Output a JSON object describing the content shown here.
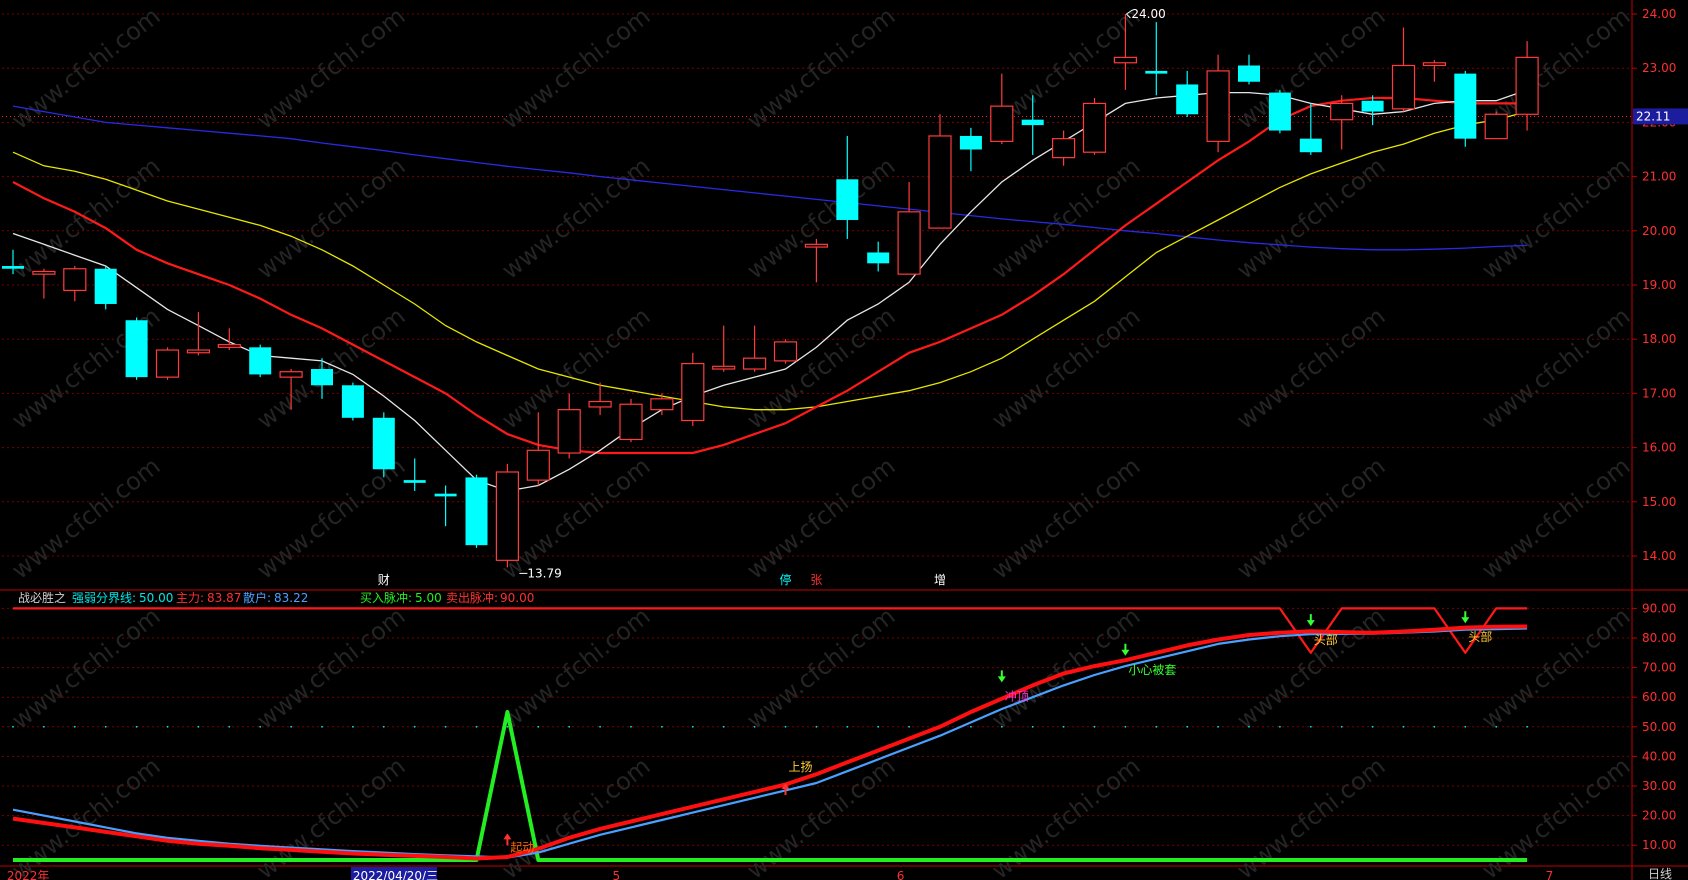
{
  "colors": {
    "up": "#ff3b3b",
    "down": "#00ffff",
    "ma5": "#e6e6e6",
    "ma10": "#ff1a1a",
    "ma20": "#e6e600",
    "ma60": "#2a2ae6",
    "grid": "#7a0000",
    "frame": "#c00000",
    "mainLine": "#ff1010",
    "retailLine": "#4aa0ff",
    "green": "#22ee22",
    "axisText": "#ff3030",
    "priceTag": "#1c1c9e"
  },
  "chart_data": [
    {
      "type": "candlestick",
      "title": "",
      "ylim": [
        13.7,
        24.2
      ],
      "yticks": [
        "24.00",
        "23.00",
        "22.00",
        "21.00",
        "20.00",
        "19.00",
        "18.00",
        "17.00",
        "16.00",
        "15.00",
        "14.00"
      ],
      "current_price": "22.11",
      "annotations": {
        "high": "24.00",
        "low": "13.79"
      },
      "event_markers": [
        "财",
        "停",
        "张",
        "增"
      ],
      "candles": [
        {
          "o": 19.35,
          "c": 19.3,
          "h": 19.65,
          "l": 19.2
        },
        {
          "o": 19.2,
          "c": 19.25,
          "h": 19.3,
          "l": 18.75
        },
        {
          "o": 18.9,
          "c": 19.3,
          "h": 19.35,
          "l": 18.7
        },
        {
          "o": 19.3,
          "c": 18.65,
          "h": 19.35,
          "l": 18.55
        },
        {
          "o": 18.35,
          "c": 17.3,
          "h": 18.4,
          "l": 17.25
        },
        {
          "o": 17.3,
          "c": 17.8,
          "h": 17.85,
          "l": 17.25
        },
        {
          "o": 17.75,
          "c": 17.8,
          "h": 18.5,
          "l": 17.7
        },
        {
          "o": 17.85,
          "c": 17.9,
          "h": 18.2,
          "l": 17.8
        },
        {
          "o": 17.85,
          "c": 17.35,
          "h": 17.9,
          "l": 17.3
        },
        {
          "o": 17.3,
          "c": 17.4,
          "h": 17.45,
          "l": 16.7
        },
        {
          "o": 17.45,
          "c": 17.15,
          "h": 17.65,
          "l": 16.9
        },
        {
          "o": 17.15,
          "c": 16.55,
          "h": 17.2,
          "l": 16.5
        },
        {
          "o": 16.55,
          "c": 15.6,
          "h": 16.65,
          "l": 15.45
        },
        {
          "o": 15.4,
          "c": 15.35,
          "h": 15.8,
          "l": 15.2
        },
        {
          "o": 15.15,
          "c": 15.1,
          "h": 15.3,
          "l": 14.55
        },
        {
          "o": 15.45,
          "c": 14.2,
          "h": 15.5,
          "l": 14.15
        },
        {
          "o": 13.92,
          "c": 15.55,
          "h": 15.7,
          "l": 13.79
        },
        {
          "o": 15.4,
          "c": 15.95,
          "h": 16.65,
          "l": 15.3
        },
        {
          "o": 15.9,
          "c": 16.7,
          "h": 17.0,
          "l": 15.8
        },
        {
          "o": 16.75,
          "c": 16.85,
          "h": 17.2,
          "l": 16.6
        },
        {
          "o": 16.15,
          "c": 16.8,
          "h": 16.9,
          "l": 16.1
        },
        {
          "o": 16.7,
          "c": 16.9,
          "h": 17.0,
          "l": 16.6
        },
        {
          "o": 16.5,
          "c": 17.55,
          "h": 17.75,
          "l": 16.4
        },
        {
          "o": 17.45,
          "c": 17.5,
          "h": 18.25,
          "l": 17.4
        },
        {
          "o": 17.45,
          "c": 17.65,
          "h": 18.25,
          "l": 17.4
        },
        {
          "o": 17.6,
          "c": 17.95,
          "h": 18.0,
          "l": 17.55
        },
        {
          "o": 19.7,
          "c": 19.75,
          "h": 19.85,
          "l": 19.05
        },
        {
          "o": 20.95,
          "c": 20.2,
          "h": 21.75,
          "l": 19.85
        },
        {
          "o": 19.6,
          "c": 19.4,
          "h": 19.8,
          "l": 19.25
        },
        {
          "o": 19.2,
          "c": 20.35,
          "h": 20.9,
          "l": 19.2
        },
        {
          "o": 20.05,
          "c": 21.75,
          "h": 22.15,
          "l": 20.05
        },
        {
          "o": 21.75,
          "c": 21.5,
          "h": 21.9,
          "l": 21.1
        },
        {
          "o": 21.65,
          "c": 22.3,
          "h": 22.9,
          "l": 21.6
        },
        {
          "o": 22.05,
          "c": 21.95,
          "h": 22.5,
          "l": 21.4
        },
        {
          "o": 21.35,
          "c": 21.7,
          "h": 21.85,
          "l": 21.2
        },
        {
          "o": 21.45,
          "c": 22.35,
          "h": 22.45,
          "l": 21.4
        },
        {
          "o": 23.1,
          "c": 23.2,
          "h": 24.0,
          "l": 22.6
        },
        {
          "o": 22.95,
          "c": 22.9,
          "h": 23.85,
          "l": 22.5
        },
        {
          "o": 22.7,
          "c": 22.15,
          "h": 22.95,
          "l": 22.1
        },
        {
          "o": 21.65,
          "c": 22.95,
          "h": 23.25,
          "l": 21.45
        },
        {
          "o": 23.05,
          "c": 22.75,
          "h": 23.25,
          "l": 22.7
        },
        {
          "o": 22.55,
          "c": 21.85,
          "h": 22.6,
          "l": 21.8
        },
        {
          "o": 21.7,
          "c": 21.45,
          "h": 22.35,
          "l": 21.4
        },
        {
          "o": 22.05,
          "c": 22.35,
          "h": 22.5,
          "l": 21.5
        },
        {
          "o": 22.4,
          "c": 22.2,
          "h": 22.5,
          "l": 21.95
        },
        {
          "o": 22.25,
          "c": 23.05,
          "h": 23.75,
          "l": 22.2
        },
        {
          "o": 23.05,
          "c": 23.1,
          "h": 23.15,
          "l": 22.75
        },
        {
          "o": 22.9,
          "c": 21.7,
          "h": 22.95,
          "l": 21.55
        },
        {
          "o": 21.7,
          "c": 22.15,
          "h": 22.2,
          "l": 21.7
        },
        {
          "o": 22.15,
          "c": 23.2,
          "h": 23.5,
          "l": 21.85
        }
      ],
      "ma5": [
        19.95,
        19.75,
        19.55,
        19.35,
        18.95,
        18.55,
        18.25,
        17.95,
        17.7,
        17.65,
        17.6,
        17.35,
        16.95,
        16.5,
        15.95,
        15.4,
        15.2,
        15.3,
        15.6,
        15.95,
        16.35,
        16.7,
        16.95,
        17.15,
        17.3,
        17.45,
        17.85,
        18.35,
        18.65,
        19.05,
        19.75,
        20.35,
        20.9,
        21.3,
        21.65,
        22.0,
        22.35,
        22.45,
        22.5,
        22.55,
        22.55,
        22.5,
        22.35,
        22.25,
        22.15,
        22.2,
        22.35,
        22.4,
        22.4,
        22.6
      ],
      "ma10": [
        20.9,
        20.6,
        20.35,
        20.05,
        19.65,
        19.4,
        19.2,
        19.0,
        18.75,
        18.45,
        18.2,
        17.9,
        17.6,
        17.3,
        17.0,
        16.6,
        16.25,
        16.05,
        15.95,
        15.9,
        15.9,
        15.9,
        15.9,
        16.05,
        16.25,
        16.45,
        16.75,
        17.05,
        17.4,
        17.75,
        17.95,
        18.2,
        18.45,
        18.8,
        19.2,
        19.65,
        20.1,
        20.5,
        20.9,
        21.3,
        21.65,
        22.05,
        22.3,
        22.4,
        22.45,
        22.45,
        22.4,
        22.35,
        22.35,
        22.35
      ],
      "ma20": [
        21.45,
        21.2,
        21.1,
        20.95,
        20.75,
        20.55,
        20.4,
        20.25,
        20.1,
        19.9,
        19.65,
        19.35,
        19.0,
        18.65,
        18.25,
        17.95,
        17.7,
        17.45,
        17.3,
        17.15,
        17.05,
        16.95,
        16.85,
        16.75,
        16.7,
        16.7,
        16.75,
        16.85,
        16.95,
        17.05,
        17.2,
        17.4,
        17.65,
        18.0,
        18.35,
        18.7,
        19.15,
        19.6,
        19.9,
        20.2,
        20.5,
        20.8,
        21.05,
        21.25,
        21.45,
        21.6,
        21.8,
        21.95,
        22.05,
        22.2
      ],
      "ma60": [
        22.3,
        22.2,
        22.1,
        22.0,
        21.95,
        21.9,
        21.85,
        21.8,
        21.75,
        21.7,
        21.62,
        21.55,
        21.48,
        21.4,
        21.33,
        21.26,
        21.19,
        21.13,
        21.07,
        21.0,
        20.94,
        20.88,
        20.82,
        20.76,
        20.7,
        20.64,
        20.58,
        20.52,
        20.46,
        20.4,
        20.34,
        20.28,
        20.22,
        20.17,
        20.12,
        20.06,
        20.0,
        19.95,
        19.89,
        19.83,
        19.78,
        19.74,
        19.7,
        19.67,
        19.65,
        19.65,
        19.66,
        19.68,
        19.71,
        19.73
      ]
    },
    {
      "type": "line",
      "title": "战必胜之",
      "legend": [
        {
          "label": "强弱分界线:",
          "value": "50.00"
        },
        {
          "label": "主力:",
          "value": "83.87"
        },
        {
          "label": "散户:",
          "value": "83.22"
        },
        {
          "label": "买入脉冲:",
          "value": "5.00"
        },
        {
          "label": "卖出脉冲:",
          "value": "90.00"
        }
      ],
      "ylim": [
        5,
        95
      ],
      "yticks": [
        "90.00",
        "80.00",
        "70.00",
        "60.00",
        "50.00",
        "40.00",
        "30.00",
        "20.00",
        "10.00"
      ],
      "series": [
        {
          "name": "主力",
          "values": [
            19,
            17.5,
            16,
            14.5,
            13,
            11.5,
            10.5,
            9.8,
            9,
            8.4,
            7.8,
            7.2,
            6.8,
            6.4,
            6.0,
            5.5,
            6.0,
            8.8,
            12.5,
            15.5,
            18,
            20.5,
            23,
            25.5,
            28,
            30.5,
            34,
            38,
            42,
            46,
            50,
            55,
            59.5,
            64,
            68,
            70.5,
            72.5,
            75,
            77.5,
            79.5,
            81,
            81.8,
            82.3,
            82.0,
            81.8,
            82.2,
            82.8,
            83.5,
            83.8,
            83.87
          ]
        },
        {
          "name": "散户",
          "values": [
            22,
            20,
            18,
            16,
            14,
            12.5,
            11.5,
            10.5,
            9.8,
            9.2,
            8.6,
            8.0,
            7.5,
            7.0,
            6.6,
            6.2,
            5.8,
            7.5,
            10.5,
            13.5,
            16,
            18.5,
            21,
            23.5,
            26,
            28.5,
            31,
            35,
            39,
            43,
            47,
            51.5,
            56,
            60,
            64,
            67.5,
            70.5,
            73,
            75.5,
            78,
            79.5,
            80.6,
            81.3,
            81.4,
            81.5,
            81.8,
            82.2,
            82.8,
            83.0,
            83.22
          ]
        },
        {
          "name": "强弱分界线",
          "values": [
            50,
            50,
            50,
            50,
            50,
            50,
            50,
            50,
            50,
            50,
            50,
            50,
            50,
            50,
            50,
            50,
            50,
            50,
            50,
            50,
            50,
            50,
            50,
            50,
            50,
            50,
            50,
            50,
            50,
            50,
            50,
            50,
            50,
            50,
            50,
            50,
            50,
            50,
            50,
            50,
            50,
            50,
            50,
            50,
            50,
            50,
            50,
            50,
            50,
            50
          ]
        },
        {
          "name": "买入脉冲",
          "values": [
            5,
            5,
            5,
            5,
            5,
            5,
            5,
            5,
            5,
            5,
            5,
            5,
            5,
            5,
            5,
            5,
            55,
            5,
            5,
            5,
            5,
            5,
            5,
            5,
            5,
            5,
            5,
            5,
            5,
            5,
            5,
            5,
            5,
            5,
            5,
            5,
            5,
            5,
            5,
            5,
            5,
            5,
            5,
            5,
            5,
            5,
            5,
            5,
            5,
            5
          ]
        },
        {
          "name": "卖出脉冲",
          "values": [
            90,
            90,
            90,
            90,
            90,
            90,
            90,
            90,
            90,
            90,
            90,
            90,
            90,
            90,
            90,
            90,
            90,
            90,
            90,
            90,
            90,
            90,
            90,
            90,
            90,
            90,
            90,
            90,
            90,
            90,
            90,
            90,
            90,
            90,
            90,
            90,
            90,
            90,
            90,
            90,
            90,
            90,
            75,
            90,
            90,
            90,
            90,
            75,
            90,
            90
          ]
        }
      ],
      "signals": [
        {
          "index": 16,
          "value": 14,
          "text": "起动",
          "arrow": "up",
          "color": "#ff3030"
        },
        {
          "index": 25,
          "value": 31,
          "text": "上扬",
          "arrow": "up",
          "color": "#ff3030"
        },
        {
          "index": 32,
          "value": 65,
          "text": "冲顶",
          "arrow": "down",
          "color": "#33ff33"
        },
        {
          "index": 36,
          "value": 74,
          "text": "小心被套",
          "arrow": "down",
          "color": "#33ff33"
        },
        {
          "index": 42,
          "value": 84,
          "text": "头部",
          "arrow": "down",
          "color": "#33ff33"
        },
        {
          "index": 47,
          "value": 85,
          "text": "头部",
          "arrow": "down",
          "color": "#33ff33"
        }
      ],
      "xlabels": [
        {
          "index": -0.2,
          "text": "2022年"
        },
        {
          "index": 11.0,
          "text": "2022/04/20/三"
        },
        {
          "index": 19.4,
          "text": "5"
        },
        {
          "index": 28.6,
          "text": "6"
        },
        {
          "index": 49.6,
          "text": "7"
        }
      ],
      "period_label": "日线"
    }
  ]
}
